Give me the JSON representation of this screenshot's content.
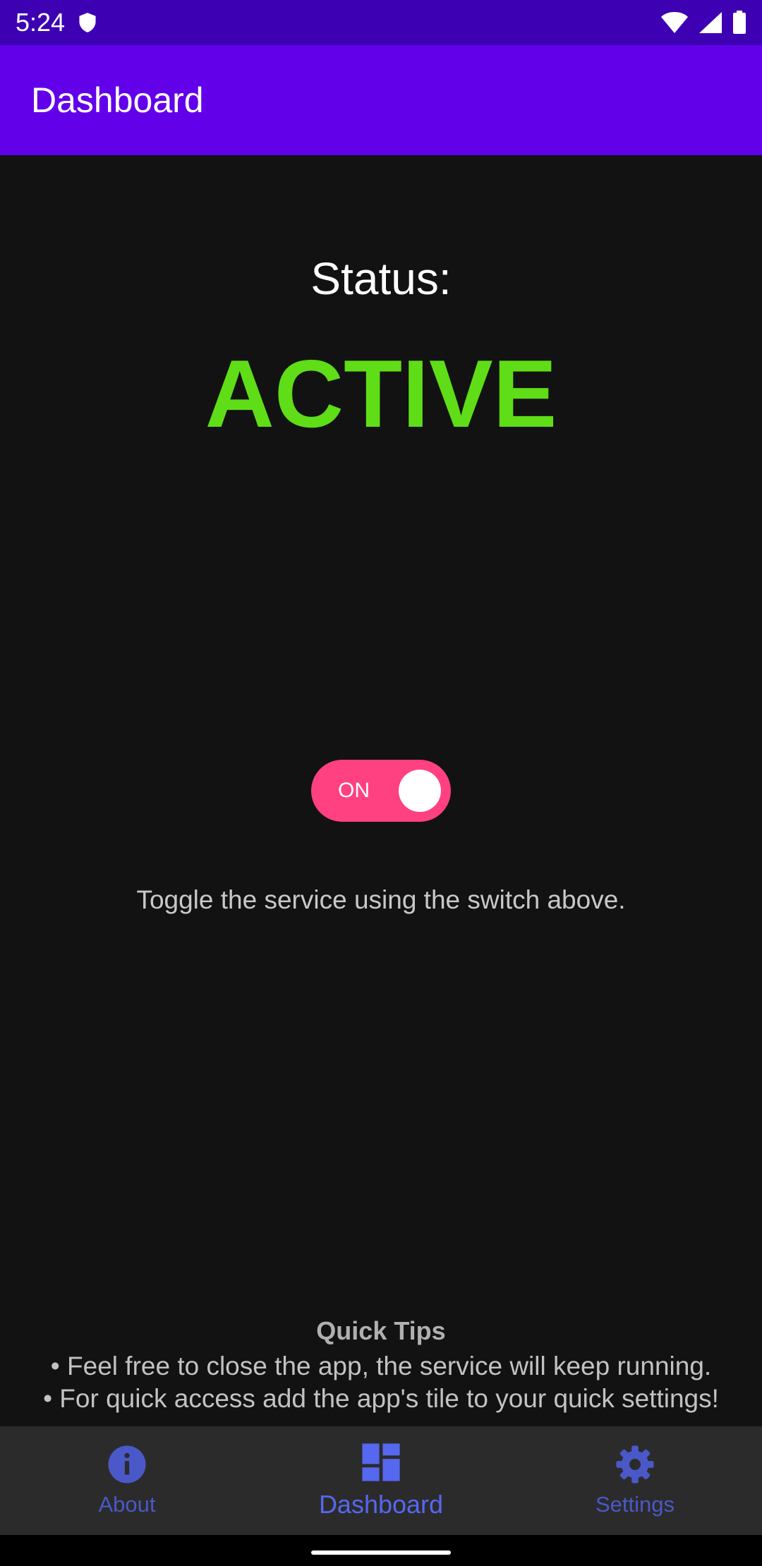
{
  "status_bar": {
    "time": "5:24",
    "icons": [
      "shield-icon",
      "wifi-icon",
      "signal-icon",
      "battery-icon"
    ]
  },
  "app_bar": {
    "title": "Dashboard"
  },
  "main": {
    "status_label": "Status:",
    "status_value": "ACTIVE",
    "status_color": "#5fdd17",
    "toggle": {
      "label": "ON",
      "state": "on",
      "color": "#ff4081"
    },
    "hint": "Toggle the service using the switch above."
  },
  "tips": {
    "title": "Quick Tips",
    "lines": [
      "• Feel free to close the app, the service will keep running.",
      "• For quick access add the app's tile to your quick settings!"
    ]
  },
  "bottom_nav": {
    "items": [
      {
        "label": "About",
        "icon": "info-icon",
        "active": false
      },
      {
        "label": "Dashboard",
        "icon": "dashboard-icon",
        "active": true
      },
      {
        "label": "Settings",
        "icon": "gear-icon",
        "active": false
      }
    ]
  },
  "colors": {
    "app_bar": "#6200ea",
    "status_bar": "#3d00b3",
    "background": "#121212",
    "nav_accent": "#5667f0"
  }
}
